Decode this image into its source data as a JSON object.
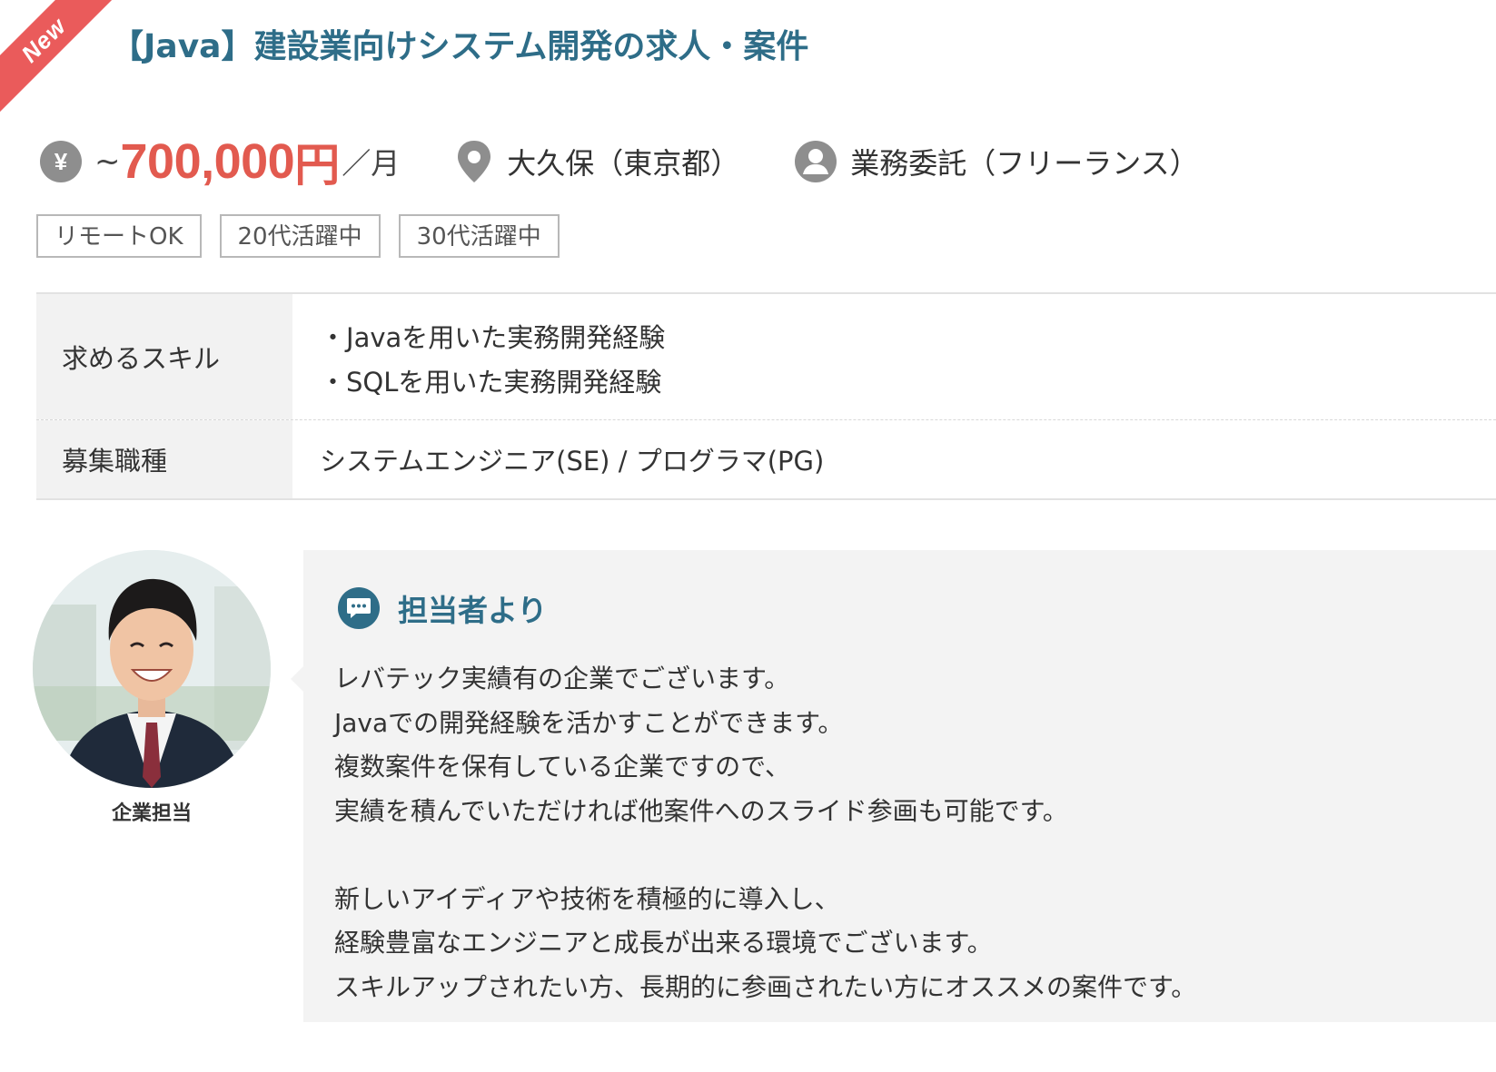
{
  "badge": {
    "label": "New",
    "color": "#ea5b5b"
  },
  "job": {
    "title": "【Java】建設業向けシステム開発の求人・案件"
  },
  "meta": {
    "salary_icon": "yen-icon",
    "salary_prefix": "~",
    "salary_value": "700,000",
    "salary_currency": "円",
    "salary_unit": "／月",
    "location_icon": "map-pin-icon",
    "location": "大久保（東京都）",
    "contract_icon": "user-icon",
    "contract": "業務委託（フリーランス）"
  },
  "tags": [
    "リモートOK",
    "20代活躍中",
    "30代活躍中"
  ],
  "details": {
    "skills_label": "求めるスキル",
    "skills": [
      "Javaを用いた実務開発経験",
      "SQLを用いた実務開発経験"
    ],
    "role_label": "募集職種",
    "role": "システムエンジニア(SE) / プログラマ(PG)"
  },
  "contact": {
    "avatar_caption": "企業担当",
    "title_icon": "chat-bubble-icon",
    "title": "担当者より",
    "message_lines": [
      "レバテック実績有の企業でございます。",
      "Javaでの開発経験を活かすことができます。",
      "複数案件を保有している企業ですので、",
      "実績を積んでいただければ他案件へのスライド参画も可能です。",
      "",
      "新しいアイディアや技術を積極的に導入し、",
      "経験豊富なエンジニアと成長が出来る環境でございます。",
      "スキルアップされたい方、長期的に参画されたい方にオススメの案件です。"
    ]
  },
  "colors": {
    "accent": "#2e6d88",
    "salary": "#e25a4f",
    "label_bg": "#f2f2f2",
    "message_bg": "#f3f3f3"
  }
}
